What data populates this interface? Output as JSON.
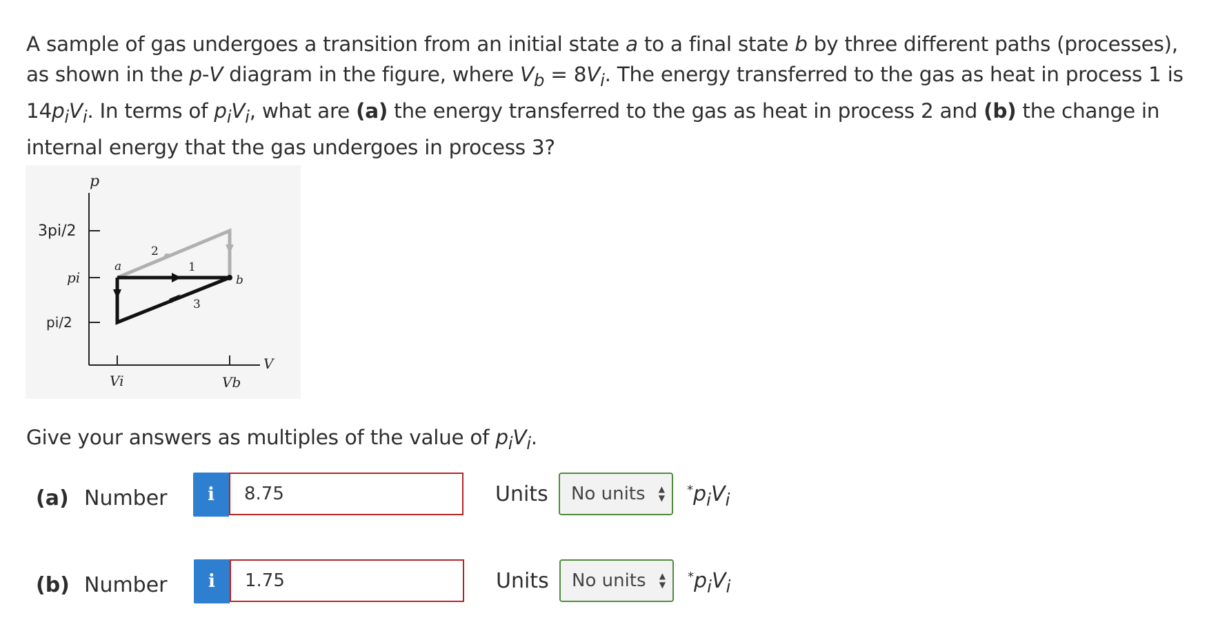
{
  "question": {
    "parts": [
      "A sample of gas undergoes a transition from an initial state ",
      "a",
      " to a final state ",
      "b",
      " by three different paths (processes), as shown in the ",
      "p",
      "-",
      "V",
      " diagram in the figure, where ",
      "V",
      "b",
      " = 8",
      "V",
      "i",
      ". The energy transferred to the gas as heat in process 1 is 14",
      "p",
      "i",
      "V",
      "i",
      ". In terms of ",
      "p",
      "i",
      "V",
      "i",
      ", what are ",
      "(a)",
      " the energy transferred to the gas as heat in process 2 and ",
      "(b)",
      " the change in internal energy that the gas undergoes in process 3?"
    ]
  },
  "figure": {
    "y_axis_label": "p",
    "x_axis_label": "V",
    "y_ticks": [
      "3pi/2",
      "pi",
      "pi/2"
    ],
    "x_ticks": [
      "Vi",
      "Vb"
    ],
    "point_a": "a",
    "point_b": "b",
    "path_labels": [
      "1",
      "2",
      "3"
    ],
    "colors": {
      "path_2": "#b0b0b0",
      "path_1_3": "#111111",
      "axes": "#222222"
    }
  },
  "instruction": {
    "text": "Give your answers as multiples of the value of ",
    "pi": "p",
    "i": "i",
    "vi": "V",
    "i2": "i",
    "end": "."
  },
  "answers": [
    {
      "part": "(a)",
      "label": "Number",
      "info": "i",
      "value": "8.75",
      "units_label": "Units",
      "units_value": "No units",
      "suffix_star": "*",
      "suffix_p": "p",
      "suffix_i": "i",
      "suffix_v": "V",
      "suffix_i2": "i"
    },
    {
      "part": "(b)",
      "label": "Number",
      "info": "i",
      "value": "1.75",
      "units_label": "Units",
      "units_value": "No units",
      "suffix_star": "*",
      "suffix_p": "p",
      "suffix_i": "i",
      "suffix_v": "V",
      "suffix_i2": "i"
    }
  ]
}
